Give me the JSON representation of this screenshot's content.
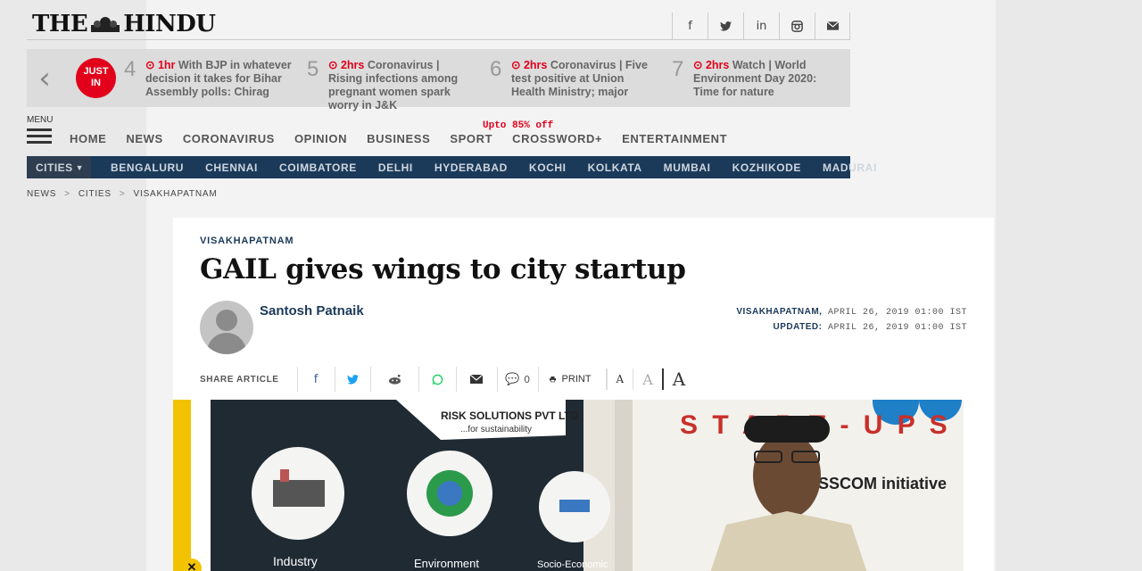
{
  "header": {
    "logo_left": "THE",
    "logo_right": "HINDU",
    "social": [
      {
        "icon": "facebook-icon",
        "glyph": "f"
      },
      {
        "icon": "twitter-icon",
        "glyph": "🐦"
      },
      {
        "icon": "linkedin-icon",
        "glyph": "in"
      },
      {
        "icon": "instagram-icon",
        "glyph": "◎"
      },
      {
        "icon": "mail-icon",
        "glyph": "✉"
      }
    ]
  },
  "just_in": {
    "badge_line1": "JUST",
    "badge_line2": "IN",
    "items": [
      {
        "num": "4",
        "time": "1hr",
        "text": "With BJP in whatever decision it takes for Bihar Assembly polls: Chirag"
      },
      {
        "num": "5",
        "time": "2hrs",
        "text": "Coronavirus | Rising infections among pregnant women spark worry in J&K"
      },
      {
        "num": "6",
        "time": "2hrs",
        "text": "Coronavirus | Five test positive at Union Health Ministry; major"
      },
      {
        "num": "7",
        "time": "2hrs",
        "text": "Watch | World Environment Day 2020: Time for nature"
      }
    ]
  },
  "nav": {
    "menu_label": "MENU",
    "promo": "Upto 85% off",
    "items": [
      "HOME",
      "NEWS",
      "CORONAVIRUS",
      "OPINION",
      "BUSINESS",
      "SPORT",
      "CROSSWORD+",
      "ENTERTAINMENT"
    ]
  },
  "cities": {
    "label": "CITIES",
    "items": [
      "BENGALURU",
      "CHENNAI",
      "COIMBATORE",
      "DELHI",
      "HYDERABAD",
      "KOCHI",
      "KOLKATA",
      "MUMBAI",
      "KOZHIKODE",
      "MADURAI"
    ]
  },
  "breadcrumb": [
    "NEWS",
    "CITIES",
    "VISAKHAPATNAM"
  ],
  "article": {
    "kicker": "VISAKHAPATNAM",
    "headline": "GAIL gives wings to city startup",
    "author": "Santosh Patnaik",
    "dateline_place": "VISAKHAPATNAM,",
    "dateline_date": "APRIL 26, 2019 01:00 IST",
    "updated_label": "UPDATED:",
    "updated_date": "APRIL 26, 2019 01:00 IST",
    "share_label": "SHARE ARTICLE",
    "comment_count": "0",
    "print_label": "PRINT",
    "font_small": "A",
    "font_medium": "A",
    "font_large": "A"
  },
  "photo": {
    "banner_text": "RISK SOLUTIONS PVT LTD",
    "banner_sub": "...for sustainability",
    "labels": [
      "Industry",
      "Environment",
      "Socio-Economic"
    ],
    "startups_text": "S T A R T - U P S",
    "nasscom_text": "NASSCOM initiative"
  }
}
